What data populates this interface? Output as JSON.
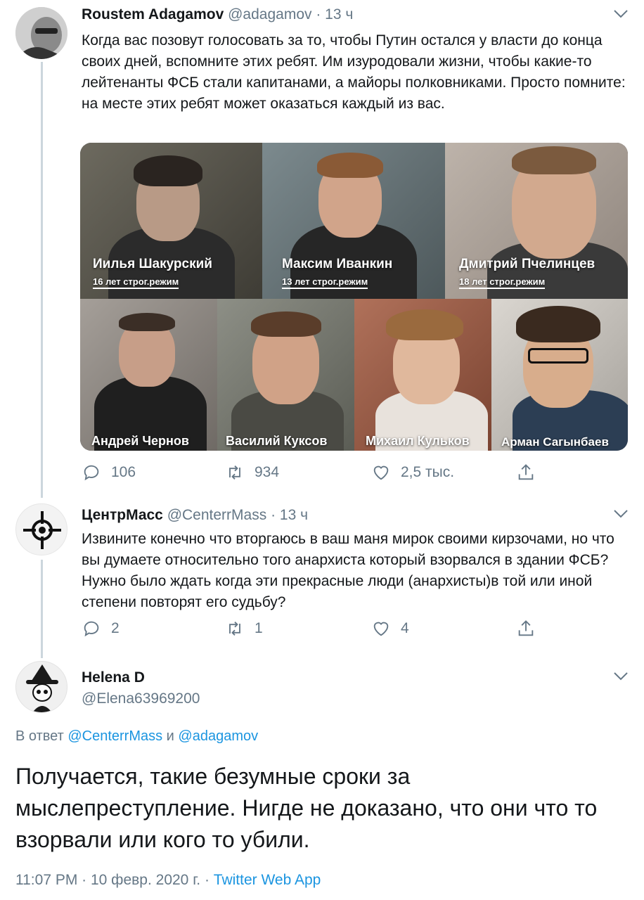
{
  "tweet1": {
    "name": "Roustem Adagamov",
    "handle": "@adagamov",
    "time": "· 13 ч",
    "text": "Когда вас позовут голосовать за то, чтобы Путин остался у власти до конца своих дней, вспомните этих ребят. Им изуродовали жизни, чтобы какие-то лейтенанты ФСБ стали капитанами, а майоры полковниками. Просто помните: на месте этих ребят может оказаться каждый из вас.",
    "photos_top": [
      {
        "name": "Иилья Шакурский",
        "sentence": "16 лет строг.режим"
      },
      {
        "name": "Максим Иванкин",
        "sentence": "13 лет строг.режим"
      },
      {
        "name": "Дмитрий Пчелинцев",
        "sentence": "18 лет строг.режим"
      }
    ],
    "photos_bottom": [
      {
        "name": "Андрей Чернов"
      },
      {
        "name": "Василий Куксов"
      },
      {
        "name": "Михаил Кульков"
      },
      {
        "name": "Арман Сагынбаев"
      }
    ],
    "replies": "106",
    "retweets": "934",
    "likes": "2,5 тыс."
  },
  "tweet2": {
    "name": "ЦентрМасс",
    "handle": "@CenterrMass",
    "time": "· 13 ч",
    "text": "Извините конечно что вторгаюсь в ваш маня мирок своими кирзочами, но что вы думаете относительно того анархиста который взорвался в здании ФСБ? Нужно было ждать когда эти прекрасные люди (анархисты)в той или иной степени повторят его судьбу?",
    "replies": "2",
    "retweets": "1",
    "likes": "4"
  },
  "tweet3": {
    "name": "Helena D",
    "handle": "@Elena63969200",
    "reply_prefix": "В ответ",
    "reply_to_1": "@CenterrMass",
    "reply_and": "и",
    "reply_to_2": "@adagamov",
    "text": "Получается, такие безумные сроки за мыслепреступление. Нигде не доказано, что они что то взорвали или кого то убили.",
    "timestamp": "11:07 PM · 10 февр. 2020 г. ·",
    "app": "Twitter Web App"
  },
  "colors": {
    "text": "#14171a",
    "secondary": "#657786",
    "link": "#1b95e0",
    "thread_line": "#ccd6dd"
  },
  "icons": [
    "reply-icon",
    "retweet-icon",
    "like-icon",
    "share-icon",
    "chevron-down-icon"
  ]
}
